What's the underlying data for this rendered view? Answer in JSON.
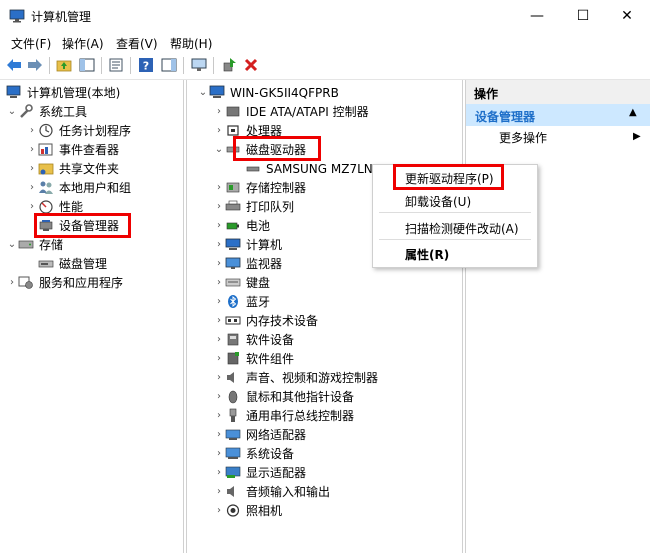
{
  "window": {
    "title": "计算机管理",
    "minimize": "—",
    "maximize": "☐",
    "close": "✕"
  },
  "menu": [
    "文件(F)",
    "操作(A)",
    "查看(V)",
    "帮助(H)"
  ],
  "left_tree": {
    "root": "计算机管理(本地)",
    "system_tools": "系统工具",
    "items": [
      "任务计划程序",
      "事件查看器",
      "共享文件夹",
      "本地用户和组",
      "性能",
      "设备管理器"
    ],
    "storage": "存储",
    "storage_items": [
      "磁盘管理"
    ],
    "services": "服务和应用程序"
  },
  "device_tree": {
    "computer": "WIN-GK5II4QFPRB",
    "categories": [
      "IDE ATA/ATAPI 控制器",
      "处理器",
      "磁盘驱动器",
      "SAMSUNG MZ7LN2",
      "存储控制器",
      "打印队列",
      "电池",
      "计算机",
      "监视器",
      "键盘",
      "蓝牙",
      "内存技术设备",
      "软件设备",
      "软件组件",
      "声音、视频和游戏控制器",
      "鼠标和其他指针设备",
      "通用串行总线控制器",
      "网络适配器",
      "系统设备",
      "显示适配器",
      "音频输入和输出",
      "照相机"
    ]
  },
  "context_menu": [
    "更新驱动程序(P)",
    "卸载设备(U)",
    "扫描检测硬件改动(A)",
    "属性(R)"
  ],
  "actions": {
    "header": "操作",
    "selected": "设备管理器",
    "more": "更多操作"
  },
  "colors": {
    "highlight": "#e00000",
    "selection": "#cde8ff",
    "accent": "#1e6fc9"
  }
}
